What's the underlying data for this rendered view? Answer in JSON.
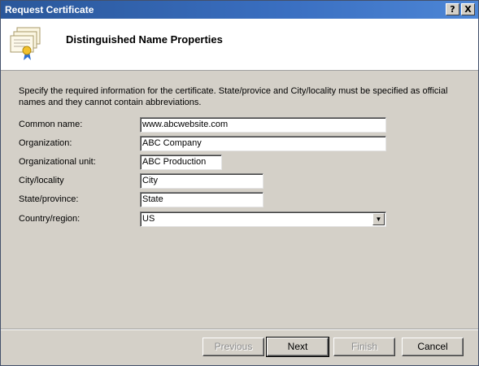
{
  "window": {
    "title": "Request Certificate",
    "help_label": "?",
    "close_label": "X"
  },
  "header": {
    "title": "Distinguished Name Properties",
    "icon": "certificate-icon"
  },
  "instructions": "Specify the required information for the certificate. State/provice and City/locality must be specified as official names and they cannot contain abbreviations.",
  "form": {
    "common_name": {
      "label": "Common name:",
      "value": "www.abcwebsite.com"
    },
    "organization": {
      "label": "Organization:",
      "value": "ABC Company"
    },
    "organizational_unit": {
      "label": "Organizational unit:",
      "value": "ABC Production"
    },
    "city": {
      "label": "City/locality",
      "value": "City"
    },
    "state": {
      "label": "State/province:",
      "value": "State"
    },
    "country": {
      "label": "Country/region:",
      "value": "US"
    }
  },
  "buttons": {
    "previous": "Previous",
    "next": "Next",
    "finish": "Finish",
    "cancel": "Cancel"
  },
  "colors": {
    "titlebar": "#2a579a",
    "dialog_bg": "#d4d0c8"
  }
}
